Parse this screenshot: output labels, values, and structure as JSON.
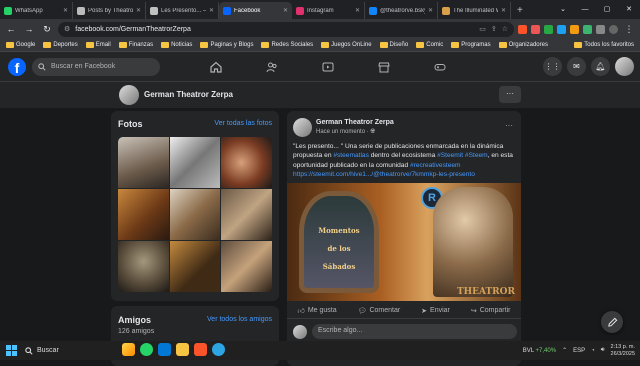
{
  "browser": {
    "tabs": [
      {
        "title": "WhatsApp",
        "color": "#25d366"
      },
      {
        "title": "Posts by TheatroVe",
        "color": "#bbbbbb"
      },
      {
        "title": "Les Presento... — St",
        "color": "#c0c0c0"
      },
      {
        "title": "Facebook",
        "color": "#0866ff"
      },
      {
        "title": "Instagram",
        "color": "#e1306c"
      },
      {
        "title": "@theatrorve.bsky.so",
        "color": "#1185fe"
      },
      {
        "title": "The Illuminated Wo",
        "color": "#d9a04a"
      }
    ],
    "url": "facebook.com/GermanTheatrorZerpa",
    "bookmarks": [
      "Google",
      "Deportes",
      "Email",
      "Finanzas",
      "Noticias",
      "Paginas y Blogs",
      "Redes Sociales",
      "Juegos OnLine",
      "Diseño",
      "Comic",
      "Programas",
      "Organizadores"
    ],
    "all_bookmarks": "Todos los favoritos"
  },
  "facebook": {
    "logo": "f",
    "search_placeholder": "Buscar en Facebook",
    "profile_name": "German Theatror Zerpa",
    "photos": {
      "title": "Fotos",
      "see_all": "Ver todas las fotos"
    },
    "friends": {
      "title": "Amigos",
      "count": "126 amigos",
      "see_all": "Ver todos los amigos"
    },
    "post": {
      "author": "German Theatror Zerpa",
      "time": "Hace un momento · ",
      "text_parts": [
        {
          "t": "\"Les presento... \" Una serie de publicaciones enmarcada en la dinámica propuesta en ",
          "link": false
        },
        {
          "t": "#steematlas",
          "link": true
        },
        {
          "t": " dentro del ecosistema ",
          "link": false
        },
        {
          "t": "#Steemit #Steem",
          "link": true
        },
        {
          "t": ", en esta oportunidad publicado en la comunidad ",
          "link": false
        },
        {
          "t": "#recreativesteem",
          "link": true
        },
        {
          "t": " ",
          "link": false
        },
        {
          "t": "https://steemit.com/hive1.../@theatrorve/7kmmkp-les-presento",
          "link": true
        }
      ],
      "image_title_1": "Momentos",
      "image_title_2": "de los",
      "image_title_3": "Sábados",
      "image_logo": "R",
      "image_brand": "THEATROR",
      "actions": {
        "like": "Me gusta",
        "comment": "Comentar",
        "send": "Enviar",
        "share": "Compartir"
      },
      "comment_placeholder": "Escribe algo..."
    }
  },
  "taskbar": {
    "search": "Buscar",
    "stock_name": "BVL",
    "stock_change": "+7,40%",
    "lang": "ESP",
    "time": "2:13 p. m.",
    "date": "26/3/2025"
  }
}
